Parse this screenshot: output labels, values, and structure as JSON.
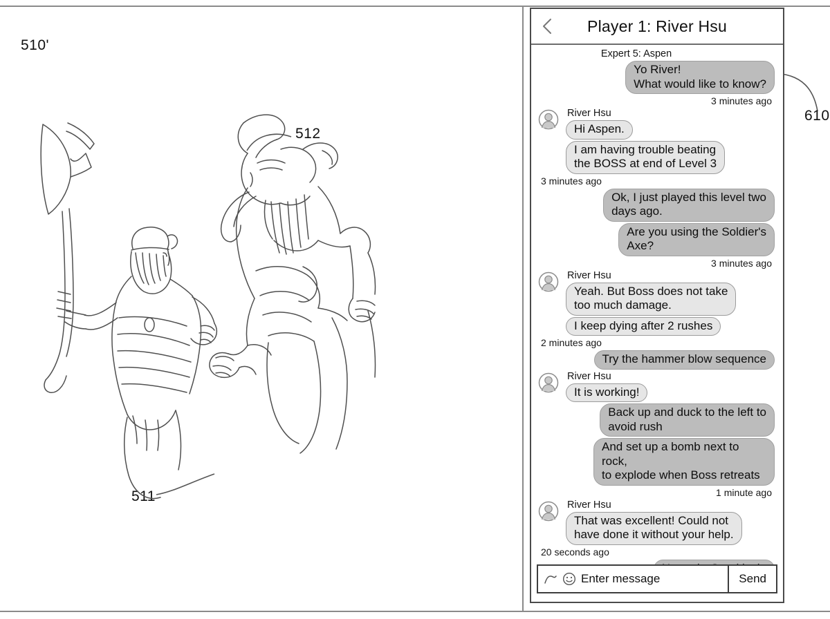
{
  "figure": {
    "ref_scene": "510'",
    "ref_boss": "512",
    "ref_player": "511",
    "ref_chat": "610",
    "scene_icon": "game-scene-line-art"
  },
  "chat": {
    "header": {
      "back_icon": "chevron-left-icon",
      "title": "Player 1: River Hsu"
    },
    "participants": {
      "expert": "Expert 5: Aspen",
      "player": "River Hsu"
    },
    "avatar_icon": "user-avatar-icon",
    "messages": [
      {
        "sender_label": "Expert 5: Aspen",
        "side": "right",
        "bubbles": [
          "Yo River!\nWhat would like to know?"
        ],
        "timestamp": "3 minutes ago"
      },
      {
        "sender_label": "River Hsu",
        "side": "left",
        "bubbles": [
          "Hi Aspen.",
          "I am having trouble beating\nthe BOSS at end of Level 3"
        ],
        "timestamp": "3 minutes ago"
      },
      {
        "sender_label": "",
        "side": "right",
        "bubbles": [
          "Ok, I just played this level two\ndays ago.",
          "Are you using the Soldier's\nAxe?"
        ],
        "timestamp": "3 minutes ago"
      },
      {
        "sender_label": "River Hsu",
        "side": "left",
        "bubbles": [
          "Yeah.  But Boss does not take\ntoo much damage.",
          "I keep dying after 2 rushes"
        ],
        "timestamp": "2 minutes ago"
      },
      {
        "sender_label": "",
        "side": "right",
        "bubbles": [
          "Try the hammer blow sequence"
        ],
        "timestamp": ""
      },
      {
        "sender_label": "River Hsu",
        "side": "left",
        "bubbles": [
          "It is working!"
        ],
        "timestamp": ""
      },
      {
        "sender_label": "",
        "side": "right",
        "bubbles": [
          "Back up and duck to the left to\navoid rush",
          "And set up a bomb next to rock,\nto explode when Boss retreats"
        ],
        "timestamp": "1 minute ago"
      },
      {
        "sender_label": "River Hsu",
        "side": "left",
        "bubbles": [
          "That was excellent! Could not\nhave done it without your help."
        ],
        "timestamp": "20 seconds ago"
      },
      {
        "sender_label": "",
        "side": "right",
        "bubbles": [
          "No prob. Good luck."
        ],
        "timestamp": ""
      }
    ],
    "composer": {
      "attach_icon": "attachment-squiggle-icon",
      "emoji_icon": "smiley-face-icon",
      "placeholder": "Enter message",
      "value": "",
      "send_label": "Send"
    }
  },
  "colors": {
    "incoming_bubble": "#e6e6e6",
    "outgoing_bubble": "#bcbcbc",
    "frame": "#4a4a4a",
    "sheet_rule": "#8a8a8a"
  }
}
